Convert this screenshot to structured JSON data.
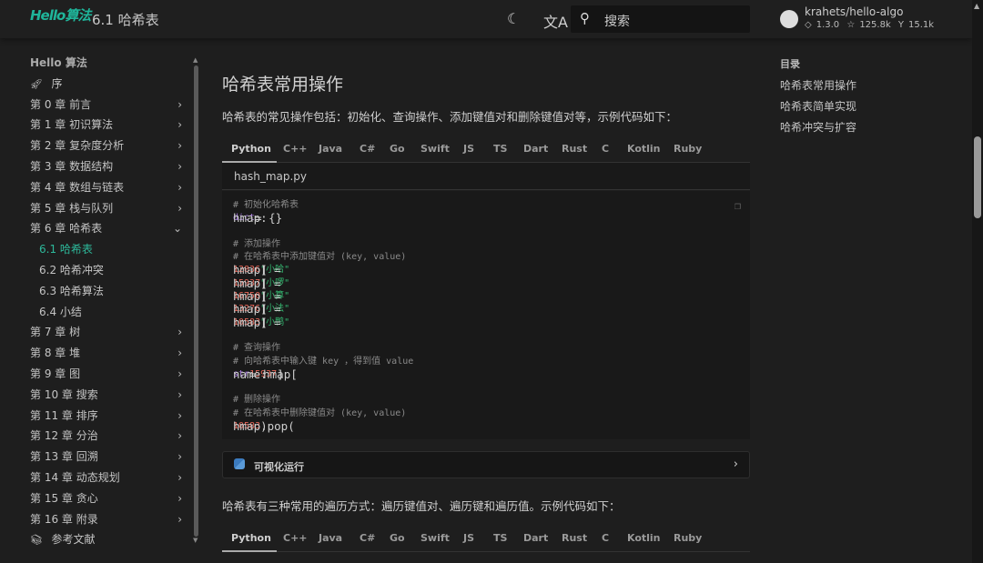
{
  "header": {
    "logo": "Hello算法",
    "title": "6.1  哈希表",
    "search_placeholder": "搜索",
    "repo": "krahets/hello-algo",
    "version": "1.3.0",
    "stars": "125.8k",
    "forks": "15.1k"
  },
  "sidebar": {
    "title": "Hello 算法",
    "items": [
      {
        "label": "序",
        "icon": "rocket-icon"
      },
      {
        "label": "第 0 章  前言",
        "chev": "›"
      },
      {
        "label": "第 1 章  初识算法",
        "chev": "›"
      },
      {
        "label": "第 2 章  复杂度分析",
        "chev": "›"
      },
      {
        "label": "第 3 章  数据结构",
        "chev": "›"
      },
      {
        "label": "第 4 章  数组与链表",
        "chev": "›"
      },
      {
        "label": "第 5 章  栈与队列",
        "chev": "›"
      },
      {
        "label": "第 6 章  哈希表",
        "chev": "⌄"
      },
      {
        "label": "6.1  哈希表",
        "sub": true,
        "active": true
      },
      {
        "label": "6.2  哈希冲突",
        "sub": true
      },
      {
        "label": "6.3  哈希算法",
        "sub": true
      },
      {
        "label": "6.4  小结",
        "sub": true
      },
      {
        "label": "第 7 章  树",
        "chev": "›"
      },
      {
        "label": "第 8 章  堆",
        "chev": "›"
      },
      {
        "label": "第 9 章  图",
        "chev": "›"
      },
      {
        "label": "第 10 章  搜索",
        "chev": "›"
      },
      {
        "label": "第 11 章  排序",
        "chev": "›"
      },
      {
        "label": "第 12 章  分治",
        "chev": "›"
      },
      {
        "label": "第 13 章  回溯",
        "chev": "›"
      },
      {
        "label": "第 14 章  动态规划",
        "chev": "›"
      },
      {
        "label": "第 15 章  贪心",
        "chev": "›"
      },
      {
        "label": "第 16 章  附录",
        "chev": "›"
      },
      {
        "label": "参考文献",
        "icon": "book-icon"
      }
    ]
  },
  "main": {
    "heading": "哈希表常用操作",
    "intro": "哈希表的常见操作包括：初始化、查询操作、添加键值对和删除键值对等，示例代码如下：",
    "tabs": [
      "Python",
      "C++",
      "Java",
      "C#",
      "Go",
      "Swift",
      "JS",
      "TS",
      "Dart",
      "Rust",
      "C",
      "Kotlin",
      "Ruby"
    ],
    "filename": "hash_map.py",
    "code": [
      [
        [
          "c",
          "# 初始化哈希表"
        ]
      ],
      [
        [
          "p",
          "hmap: "
        ],
        [
          "k",
          "dict"
        ],
        [
          "p",
          " = {}"
        ]
      ],
      [],
      [
        [
          "c",
          "# 添加操作"
        ]
      ],
      [
        [
          "c",
          "# 在哈希表中添加键值对 (key, value)"
        ]
      ],
      [
        [
          "p",
          "hmap["
        ],
        [
          "n",
          "12836"
        ],
        [
          "p",
          "] = "
        ],
        [
          "s",
          "\"小哈\""
        ]
      ],
      [
        [
          "p",
          "hmap["
        ],
        [
          "n",
          "15937"
        ],
        [
          "p",
          "] = "
        ],
        [
          "s",
          "\"小啰\""
        ]
      ],
      [
        [
          "p",
          "hmap["
        ],
        [
          "n",
          "16750"
        ],
        [
          "p",
          "] = "
        ],
        [
          "s",
          "\"小算\""
        ]
      ],
      [
        [
          "p",
          "hmap["
        ],
        [
          "n",
          "13276"
        ],
        [
          "p",
          "] = "
        ],
        [
          "s",
          "\"小法\""
        ]
      ],
      [
        [
          "p",
          "hmap["
        ],
        [
          "n",
          "10583"
        ],
        [
          "p",
          "] = "
        ],
        [
          "s",
          "\"小鸭\""
        ]
      ],
      [],
      [
        [
          "c",
          "# 查询操作"
        ]
      ],
      [
        [
          "c",
          "# 向哈希表中输入键 key ，得到值 value"
        ]
      ],
      [
        [
          "p",
          "name: "
        ],
        [
          "k",
          "str"
        ],
        [
          "p",
          " = hmap["
        ],
        [
          "n",
          "15937"
        ],
        [
          "p",
          "]"
        ]
      ],
      [],
      [
        [
          "c",
          "# 删除操作"
        ]
      ],
      [
        [
          "c",
          "# 在哈希表中删除键值对 (key, value)"
        ]
      ],
      [
        [
          "p",
          "hmap.pop("
        ],
        [
          "n",
          "10583"
        ],
        [
          "p",
          ")"
        ]
      ]
    ],
    "viz_label": "可视化运行",
    "traverse_intro": "哈希表有三种常用的遍历方式：遍历键值对、遍历键和遍历值。示例代码如下："
  },
  "toc": {
    "title": "目录",
    "items": [
      "哈希表常用操作",
      "哈希表简单实现",
      "哈希冲突与扩容"
    ]
  }
}
